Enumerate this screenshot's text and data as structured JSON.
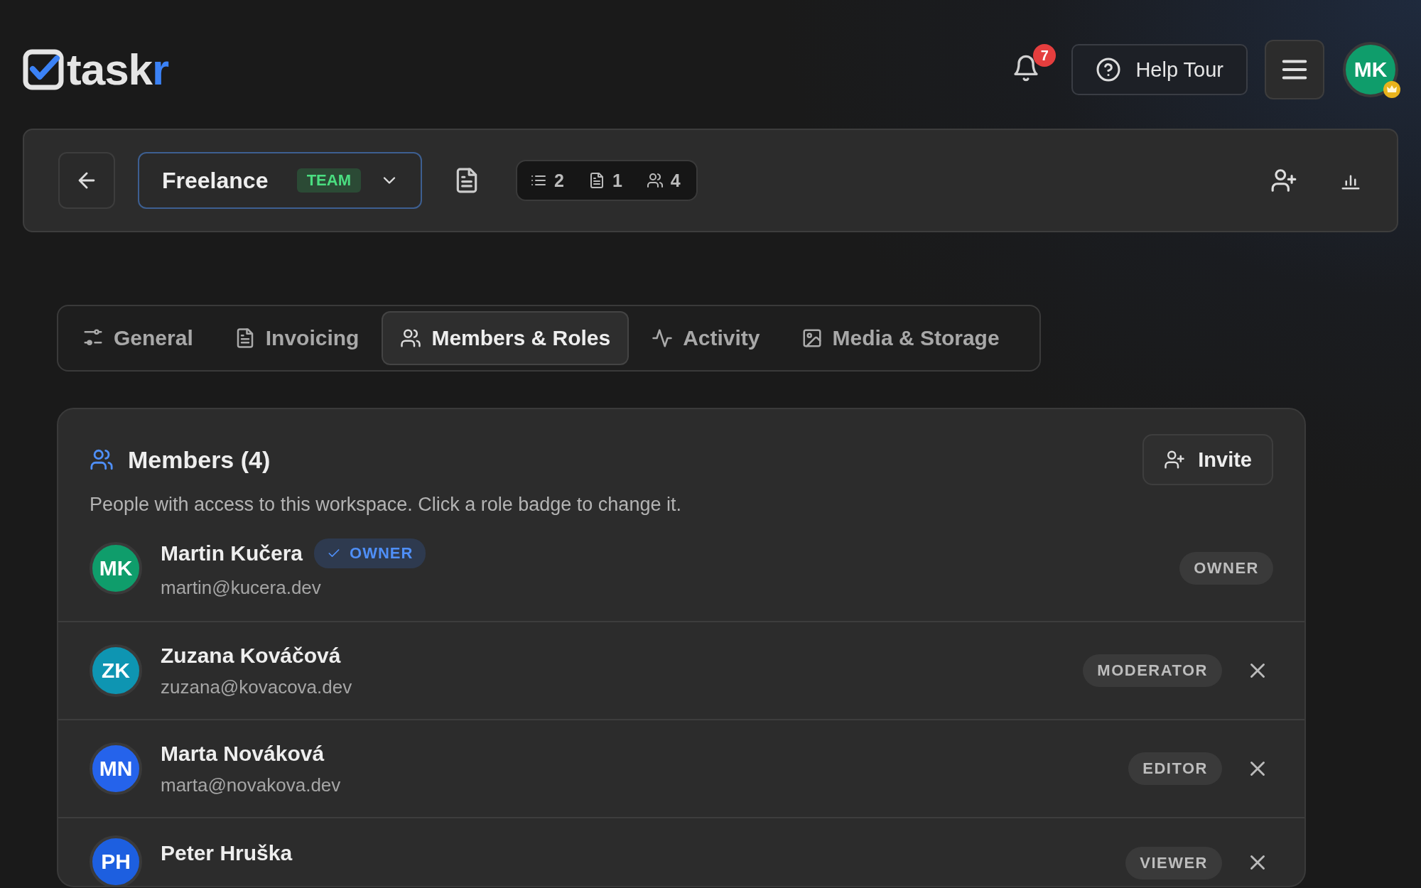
{
  "header": {
    "logo": {
      "text": "task",
      "accent": "r"
    },
    "notifications": {
      "count": "7"
    },
    "help_button": {
      "label": "Help Tour"
    },
    "user": {
      "initials": "MK",
      "color": "#0f9d6b"
    }
  },
  "toolbar": {
    "workspace": {
      "name": "Freelance",
      "badge": "TEAM"
    },
    "stats": [
      {
        "kind": "lists",
        "value": "2"
      },
      {
        "kind": "documents",
        "value": "1"
      },
      {
        "kind": "members",
        "value": "4"
      }
    ]
  },
  "tabs": [
    {
      "kind": "sliders",
      "label": "General",
      "selected": false
    },
    {
      "kind": "document",
      "label": "Invoicing",
      "selected": false
    },
    {
      "kind": "users",
      "label": "Members & Roles",
      "selected": true
    },
    {
      "kind": "pulse",
      "label": "Activity",
      "selected": false
    },
    {
      "kind": "image",
      "label": "Media & Storage",
      "selected": false
    }
  ],
  "members_card": {
    "title": "Members (4)",
    "invite_button": "Invite",
    "description": "People with access to this workspace. Click a role badge to change it.",
    "members": [
      {
        "initials": "MK",
        "color": "#0f9d6b",
        "name": "Martin Kučera",
        "owner_tag": "OWNER",
        "email": "martin@kucera.dev",
        "role": "OWNER",
        "removable": false
      },
      {
        "initials": "ZK",
        "color": "#0e95b2",
        "name": "Zuzana Kováčová",
        "email": "zuzana@kovacova.dev",
        "role": "MODERATOR",
        "removable": true
      },
      {
        "initials": "MN",
        "color": "#2563eb",
        "name": "Marta Nováková",
        "email": "marta@novakova.dev",
        "role": "EDITOR",
        "removable": true
      },
      {
        "initials": "PH",
        "color": "#1d5fe0",
        "name": "Peter Hruška",
        "role": "VIEWER",
        "removable": true
      }
    ]
  }
}
